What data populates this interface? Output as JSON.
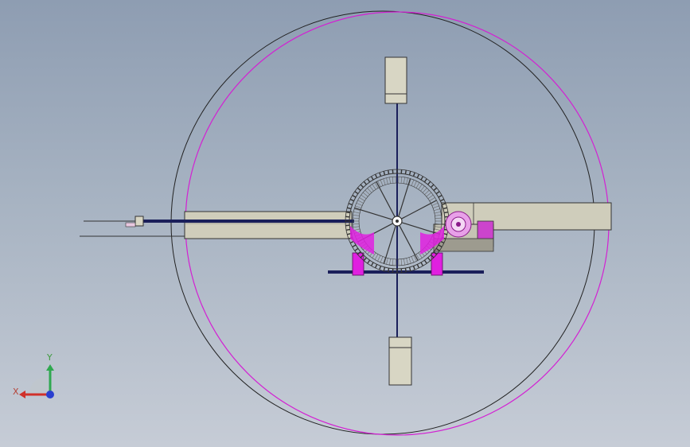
{
  "viewport": {
    "background_top": "#8e9db2",
    "background_bottom": "#c6ccd6",
    "accent_magenta": "#e020e0",
    "accent_navy": "#1a1f5a"
  },
  "triad": {
    "x_label": "X",
    "y_label": "Y",
    "x_color": "#d0302a",
    "y_color": "#2fa84f",
    "z_color": "#2a3fd0"
  }
}
